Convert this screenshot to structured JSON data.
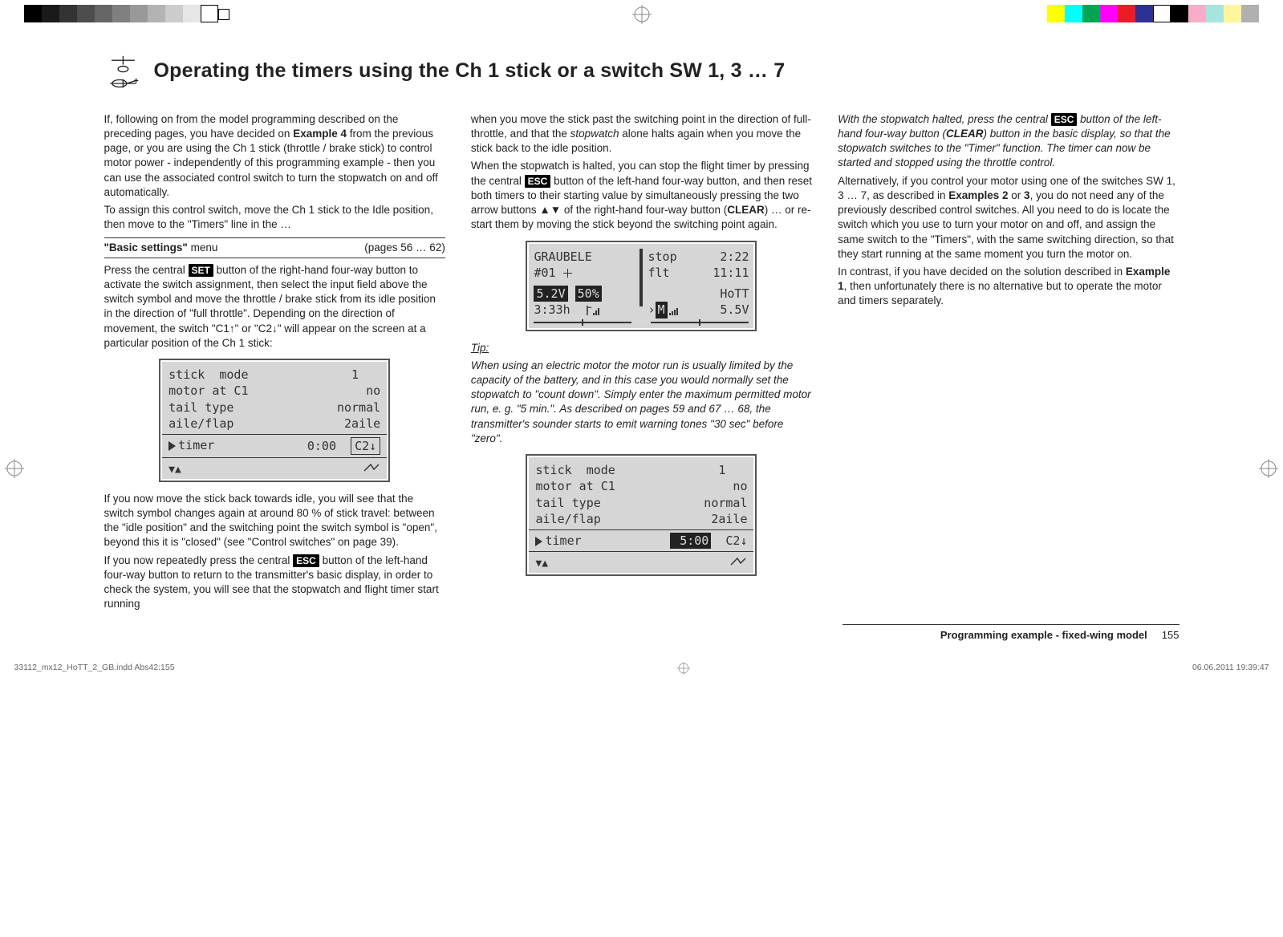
{
  "title": "Operating the timers using the Ch 1 stick or a switch SW 1, 3 … 7",
  "col1": {
    "p1a": "If, following on from the model programming described on the preceding pages, you have decided on ",
    "p1b": "Example 4",
    "p1c": " from the previous page, or you are using the Ch 1 stick (throttle / brake stick) to control motor power - independently of this programming example - then you can use the associated control switch to turn the stopwatch on and off automatically.",
    "p2": "To assign this control switch, move the Ch 1 stick to the Idle position, then move to the \"Timers\" line in the …",
    "menu_label": "\"Basic settings\"",
    "menu_word": " menu",
    "menu_ref": "(pages 56 … 62)",
    "p3a": "Press the central ",
    "p3b": "SET",
    "p3c": " button of the right-hand four-way button to activate the switch assignment, then select the input field above the switch symbol and move the throttle / brake stick from its idle position in the direction of \"full throttle\". Depending on the direction of movement, the switch \"C1↑\" or \"C2↓\" will appear on the screen at a particular position of the Ch 1 stick:",
    "p4": "If you now move the stick back towards idle, you will see that the switch symbol changes again at around 80 % of stick travel: between the \"idle position\" and the switching point the switch symbol is \"open\", beyond this it is \"closed\" (see \"Control switches\" on page 39).",
    "p5a": "If you now repeatedly press the central ",
    "p5b": "ESC",
    "p5c": " button of the left-hand four-way button to return to the transmitter's basic display, in order to check the system, you will see that the stopwatch and flight timer start running"
  },
  "screen1": {
    "r1l": "stick  mode",
    "r1r": "1   ",
    "r2l": "motor at C1",
    "r2r": "no",
    "r3l": "tail type",
    "r3r": "normal",
    "r4l": "aile/flap",
    "r4r": "2aile",
    "r5l": "timer",
    "r5r_time": "0:00",
    "r5r_sw": "C2↓"
  },
  "col2": {
    "p1a": "when you move the stick past the switching point in the direction of full-throttle, and that the ",
    "p1b": "stopwatch",
    "p1c": " alone halts again when you move the stick back to the idle position.",
    "p2a": "When the stopwatch is halted, you can stop the flight timer by pressing the central ",
    "p2b": "ESC",
    "p2c": " button of the left-hand four-way button, and then reset both timers to their starting value by simultaneously pressing the two arrow buttons ▲▼ of the right-hand four-way button (",
    "p2d": "CLEAR",
    "p2e": ") … or re-start them by moving the stick beyond the switching point again.",
    "tip_label": "Tip:",
    "tip_body": "When using an electric motor the motor run is usually limited by the capacity of the battery, and in this case you would normally set the stopwatch to \"count down\". Simply enter the maximum permitted motor run, e. g. \"5 min.\". As described on pages 59 and 67 … 68, the transmitter's sounder starts to emit warning tones \"30 sec\" before \"zero\"."
  },
  "main_screen": {
    "l1l": "GRAUBELE",
    "l2l": "#01",
    "l3l_v": "5.2V",
    "l3l_p": "50%",
    "l4l": "3:33h",
    "r1a": "stop",
    "r1b": "2:22",
    "r2a": "flt",
    "r2b": "11:11",
    "r3": "HoTT",
    "r4a": "M",
    "r4b": "5.5V"
  },
  "screen3": {
    "r1l": "stick  mode",
    "r1r": "1   ",
    "r2l": "motor at C1",
    "r2r": "no",
    "r3l": "tail type",
    "r3r": "normal",
    "r4l": "aile/flap",
    "r4r": "2aile",
    "r5l": "timer",
    "r5r_time": "5:00",
    "r5r_sw": "C2↓"
  },
  "col3": {
    "i1a": "With the stopwatch halted, press the central ",
    "i1b": "ESC",
    "i1c": " button of the left-hand four-way button (",
    "i1d": "CLEAR",
    "i1e": ") button in the basic display, so that the stopwatch switches to the \"Timer\" function. The timer can now be started and stopped using the throttle control.",
    "p2a": "Alternatively, if you control your motor using one of the switches SW 1, 3 … 7, as described in ",
    "p2b": "Examples 2",
    "p2c": " or ",
    "p2d": "3",
    "p2e": ", you do not need any of the previously described control switches. All you need to do is locate the switch which you use to turn your motor on and off, and assign the same switch to the \"Timers\", with the same switching direction, so that they start running at the same moment you turn the motor on.",
    "p3a": "In contrast, if you have decided on the solution described in ",
    "p3b": "Example 1",
    "p3c": ", then unfortunately there is no alternative but to operate the motor and timers separately."
  },
  "footer": {
    "section": "Programming example - fixed-wing model",
    "page_no": "155",
    "file": "33112_mx12_HoTT_2_GB.indd   Abs42:155",
    "datetime": "06.06.2011   19:39:47"
  }
}
